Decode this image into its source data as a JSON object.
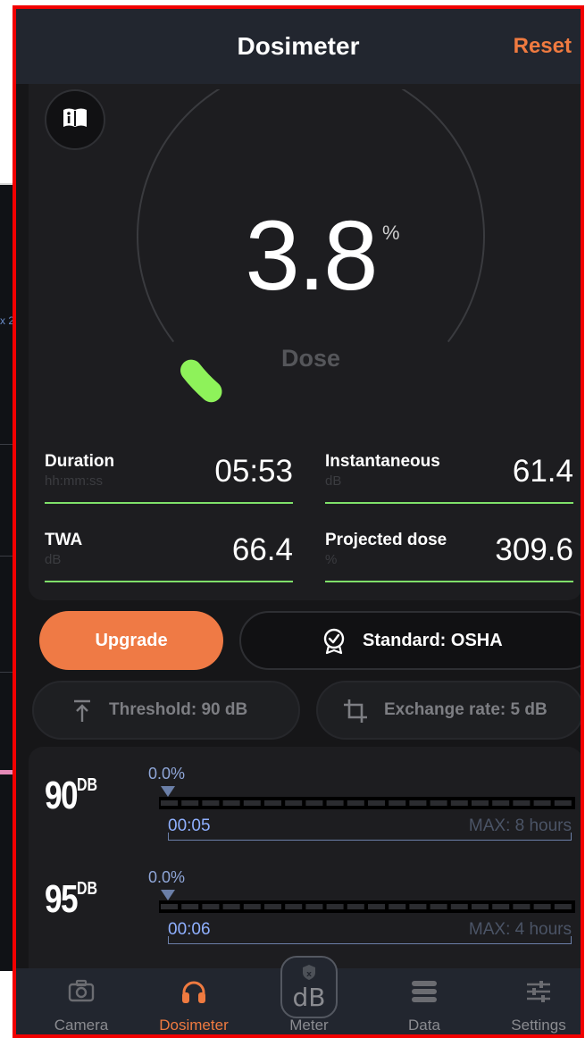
{
  "header": {
    "title": "Dosimeter",
    "reset_label": "Reset"
  },
  "gauge": {
    "value": "3.8",
    "unit": "%",
    "label": "Dose",
    "accent": "#8ef25a",
    "dose_percent": 3.8
  },
  "stats": [
    {
      "label": "Duration",
      "unit": "hh:mm:ss",
      "value": "05:53"
    },
    {
      "label": "Instantaneous",
      "unit": "dB",
      "value": "61.4"
    },
    {
      "label": "TWA",
      "unit": "dB",
      "value": "66.4"
    },
    {
      "label": "Projected dose",
      "unit": "%",
      "value": "309.6"
    }
  ],
  "actions": {
    "upgrade_label": "Upgrade",
    "standard_label": "Standard: OSHA",
    "threshold_label": "Threshold: 90 dB",
    "exchange_label": "Exchange rate: 5 dB"
  },
  "levels": [
    {
      "level": "90",
      "unit": "DB",
      "percent": "0.0%",
      "time": "00:05",
      "max": "MAX: 8 hours"
    },
    {
      "level": "95",
      "unit": "DB",
      "percent": "0.0%",
      "time": "00:06",
      "max": "MAX: 4 hours"
    }
  ],
  "tabs": [
    {
      "label": "Camera",
      "icon": "camera-icon"
    },
    {
      "label": "Dosimeter",
      "icon": "headphones-icon",
      "active": true
    },
    {
      "label": "Meter",
      "icon": "db-icon"
    },
    {
      "label": "Data",
      "icon": "database-icon"
    },
    {
      "label": "Settings",
      "icon": "sliders-icon"
    }
  ],
  "colors": {
    "accent_orange": "#ef7a40",
    "accent_green": "#7fe06a",
    "background": "#161618"
  }
}
